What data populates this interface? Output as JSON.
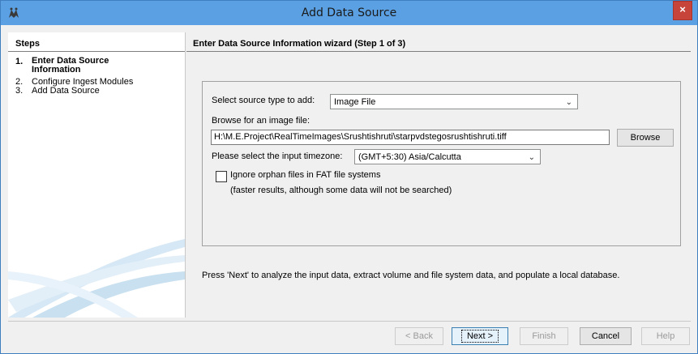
{
  "window": {
    "title": "Add Data Source",
    "close_label": "×"
  },
  "steps": {
    "header": "Steps",
    "items": [
      {
        "num": "1.",
        "label": "Enter Data Source Information",
        "active": true
      },
      {
        "num": "2.",
        "label": "Configure Ingest Modules",
        "active": false
      },
      {
        "num": "3.",
        "label": "Add Data Source",
        "active": false
      }
    ]
  },
  "wizard": {
    "header": "Enter Data Source Information wizard (Step 1 of 3)",
    "source_type_label": "Select source type to add:",
    "source_type_value": "Image File",
    "browse_label": "Browse for an image file:",
    "path_value": "H:\\M.E.Project\\RealTimeImages\\Srushtishruti\\starpvdstegosrushtishruti.tiff",
    "browse_button": "Browse",
    "timezone_label": "Please select the input timezone:",
    "timezone_value": "(GMT+5:30) Asia/Calcutta",
    "ignore_orphan_label": "Ignore orphan files in FAT file systems",
    "ignore_orphan_checked": false,
    "ignore_orphan_note": "(faster results, although some data will not be searched)",
    "next_hint": "Press 'Next' to analyze the input data, extract volume and file system data, and populate a local database."
  },
  "buttons": {
    "back": "< Back",
    "next": "Next >",
    "finish": "Finish",
    "cancel": "Cancel",
    "help": "Help"
  },
  "colors": {
    "titlebar": "#5aa0e2",
    "close": "#c7443b"
  }
}
